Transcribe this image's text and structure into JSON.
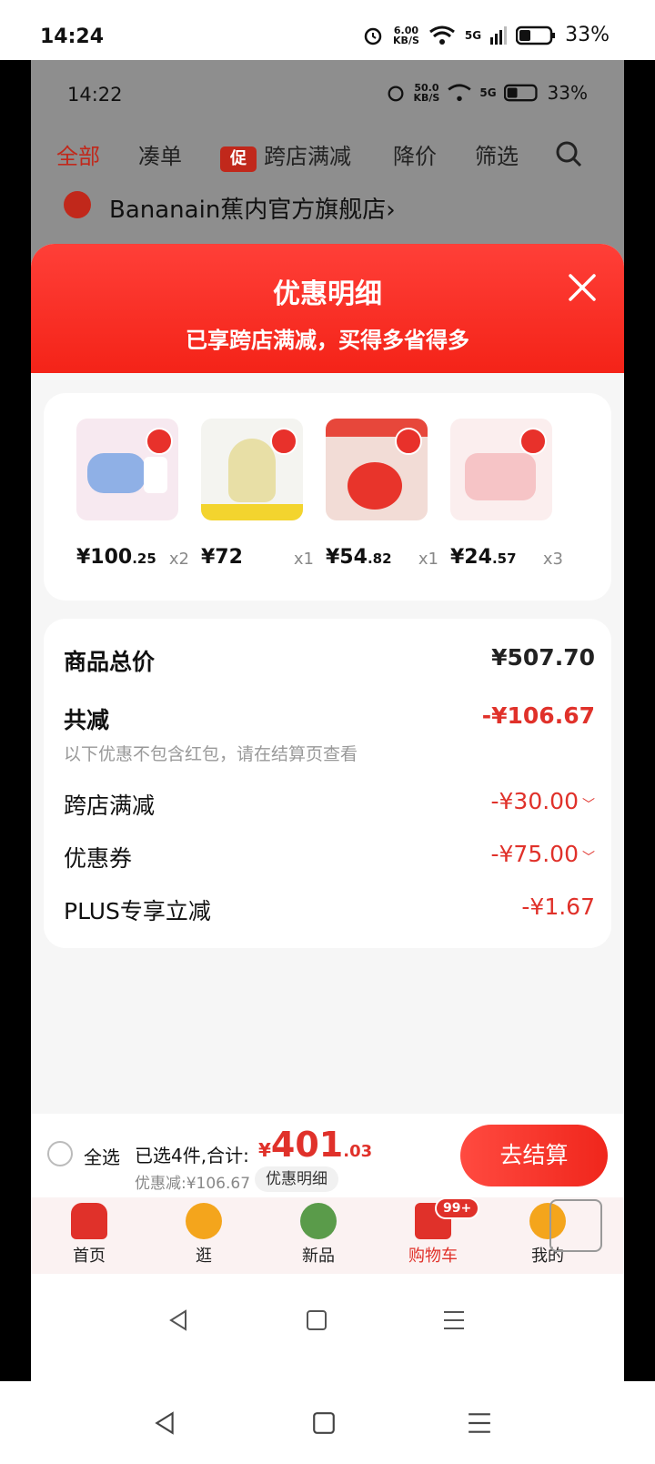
{
  "outer_status": {
    "time": "14:24",
    "speed_top": "6.00",
    "speed_unit": "KB/S",
    "net": "5G",
    "battery": "33%"
  },
  "inner_status": {
    "time": "14:22",
    "speed_top": "50.0",
    "speed_unit": "KB/S",
    "net": "5G",
    "battery": "33%"
  },
  "filter_tabs": {
    "all": "全部",
    "combine": "凑单",
    "promo_badge": "促",
    "cross_store": "跨店满减",
    "price_drop": "降价",
    "filter": "筛选"
  },
  "store": {
    "name": "Bananain蕉内官方旗舰店",
    "arrow": "›"
  },
  "sheet": {
    "title": "优惠明细",
    "subtitle": "已享跨店满减，买得多省得多",
    "products": [
      {
        "price_int": "¥100",
        "price_dec": ".25",
        "qty": "x2",
        "thumb_icon": "hot-water-bottle-blue-icon"
      },
      {
        "price_int": "¥72",
        "price_dec": "",
        "qty": "x1",
        "thumb_icon": "hot-water-bottle-yellow-icon"
      },
      {
        "price_int": "¥54",
        "price_dec": ".82",
        "qty": "x1",
        "thumb_icon": "hand-warmer-red-icon"
      },
      {
        "price_int": "¥24",
        "price_dec": ".57",
        "qty": "x3",
        "thumb_icon": "hot-water-bottle-pink-icon"
      }
    ],
    "summary": {
      "total_label": "商品总价",
      "total_value": "¥507.70",
      "reduce_label": "共减",
      "reduce_value": "-¥106.67",
      "note": "以下优惠不包含红包，请在结算页查看",
      "cross_label": "跨店满减",
      "cross_value": "-¥30.00",
      "coupon_label": "优惠券",
      "coupon_value": "-¥75.00",
      "plus_label": "PLUS专享立减",
      "plus_value": "-¥1.67"
    }
  },
  "checkout": {
    "select_all": "全选",
    "selected_label": "已选4件,合计:",
    "currency": "¥",
    "amount_int": "401",
    "amount_dec": ".03",
    "saved": "优惠减:¥106.67",
    "detail": "优惠明细",
    "pay": "去结算"
  },
  "tabbar": {
    "items": [
      {
        "label": "首页",
        "icon": "home-icon"
      },
      {
        "label": "逛",
        "icon": "stroll-icon"
      },
      {
        "label": "新品",
        "icon": "new-products-icon"
      },
      {
        "label": "购物车",
        "icon": "cart-icon",
        "badge": "99+"
      },
      {
        "label": "我的",
        "icon": "profile-icon"
      }
    ]
  },
  "colors": {
    "accent": "#e0312a",
    "header_red": "#f42318",
    "dim_overlay": "#8e8e8e"
  }
}
